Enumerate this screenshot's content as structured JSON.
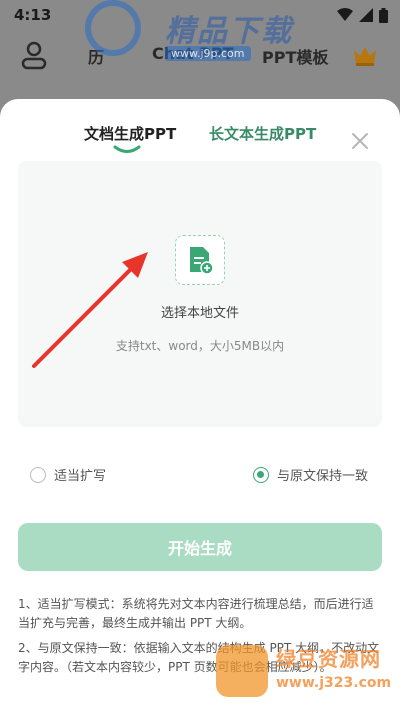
{
  "status_bar": {
    "time": "4:13"
  },
  "background_app": {
    "tab_left_partial": "历",
    "tab_center": "Chat PPT",
    "tab_ppt_template": "PPT模板"
  },
  "watermark_top": {
    "text": "精品下载",
    "url": "www.j9p.com"
  },
  "sheet": {
    "tabs": [
      {
        "label": "文档生成PPT",
        "active": true
      },
      {
        "label": "长文本生成PPT",
        "active": false
      }
    ],
    "upload": {
      "label": "选择本地文件",
      "hint": "支持txt、word，大小5MB以内"
    },
    "options": [
      {
        "label": "适当扩写",
        "checked": false
      },
      {
        "label": "与原文保持一致",
        "checked": true
      }
    ],
    "start_button": "开始生成",
    "descriptions": [
      "1、适当扩写模式：系统将先对文本内容进行梳理总结，而后进行适当扩充与完善，最终生成并输出 PPT 大纲。",
      "2、与原文保持一致：依据输入文本的结构生成 PPT 大纲，不改动文字内容。（若文本内容较少，PPT 页数可能也会相应减少）。"
    ]
  },
  "watermark_bottom": {
    "brand": "绿豆资源网",
    "site": "www.j323.com"
  },
  "colors": {
    "accent": "#3aa874",
    "button_disabled": "#a9dcc3",
    "overlay": "#8a8a8a"
  }
}
